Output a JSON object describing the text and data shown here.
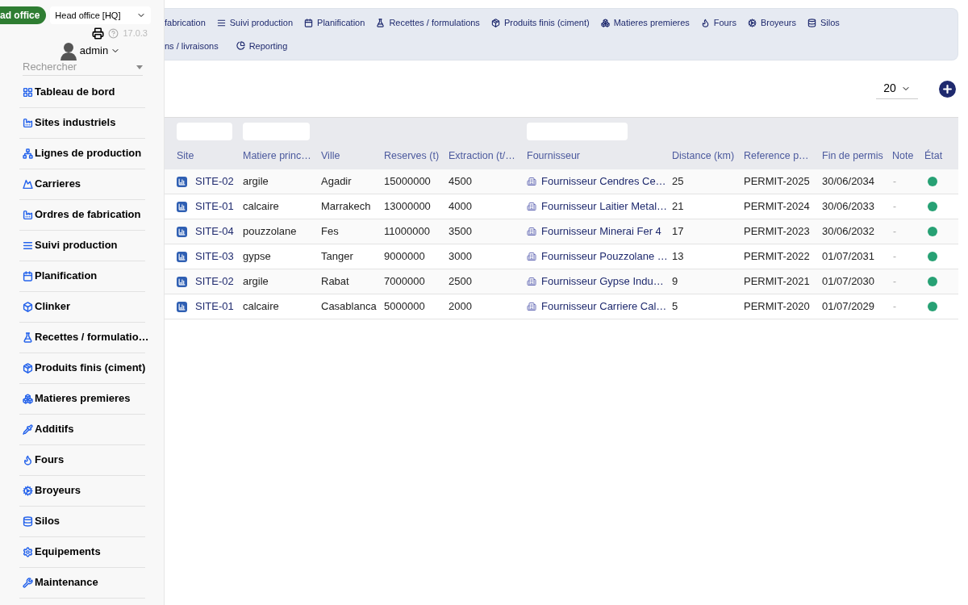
{
  "header": {
    "org_badge": "ad office",
    "site_select": "Head office [HQ]",
    "version": "17.0.3",
    "user": "admin",
    "search_placeholder": "Rechercher"
  },
  "sidebar": {
    "items": [
      {
        "label": "Tableau de bord"
      },
      {
        "label": "Sites industriels"
      },
      {
        "label": "Lignes de production"
      },
      {
        "label": "Carrieres"
      },
      {
        "label": "Ordres de fabrication"
      },
      {
        "label": "Suivi production"
      },
      {
        "label": "Planification"
      },
      {
        "label": "Clinker"
      },
      {
        "label": "Recettes / formulatio…"
      },
      {
        "label": "Produits finis (ciment)"
      },
      {
        "label": "Matieres premieres"
      },
      {
        "label": "Additifs"
      },
      {
        "label": "Fours"
      },
      {
        "label": "Broyeurs"
      },
      {
        "label": "Silos"
      },
      {
        "label": "Equipements"
      },
      {
        "label": "Maintenance"
      }
    ]
  },
  "top_nav": {
    "rows": [
      [
        "fabrication",
        "Suivi production",
        "Planification",
        "Recettes / formulations",
        "Produits finis (ciment)",
        "Matieres premieres",
        "Fours",
        "Broyeurs",
        "Silos"
      ],
      [
        "ns / livraisons",
        "Reporting"
      ]
    ]
  },
  "toolbar": {
    "page_size": "20"
  },
  "table": {
    "columns": [
      "Site",
      "Matiere princ…",
      "Ville",
      "Reserves (t)",
      "Extraction (t/…",
      "Fournisseur",
      "Distance (km)",
      "Reference p…",
      "Fin de permis",
      "Note",
      "État"
    ],
    "rows": [
      {
        "site": "SITE-02",
        "matiere": "argile",
        "ville": "Agadir",
        "reserves": "15000000",
        "extraction": "4500",
        "fournisseur": "Fournisseur Cendres Ce…",
        "distance": "25",
        "reference": "PERMIT-2025",
        "fin": "30/06/2034",
        "note": "-",
        "color": "#27a174"
      },
      {
        "site": "SITE-01",
        "matiere": "calcaire",
        "ville": "Marrakech",
        "reserves": "13000000",
        "extraction": "4000",
        "fournisseur": "Fournisseur Laitier Metal…",
        "distance": "21",
        "reference": "PERMIT-2024",
        "fin": "30/06/2033",
        "note": "-",
        "color": "#27a174"
      },
      {
        "site": "SITE-04",
        "matiere": "pouzzolane",
        "ville": "Fes",
        "reserves": "11000000",
        "extraction": "3500",
        "fournisseur": "Fournisseur Minerai Fer 4",
        "distance": "17",
        "reference": "PERMIT-2023",
        "fin": "30/06/2032",
        "note": "-",
        "color": "#27a174"
      },
      {
        "site": "SITE-03",
        "matiere": "gypse",
        "ville": "Tanger",
        "reserves": "9000000",
        "extraction": "3000",
        "fournisseur": "Fournisseur Pouzzolane …",
        "distance": "13",
        "reference": "PERMIT-2022",
        "fin": "01/07/2031",
        "note": "-",
        "color": "#27a174"
      },
      {
        "site": "SITE-02",
        "matiere": "argile",
        "ville": "Rabat",
        "reserves": "7000000",
        "extraction": "2500",
        "fournisseur": "Fournisseur Gypse Indu…",
        "distance": "9",
        "reference": "PERMIT-2021",
        "fin": "01/07/2030",
        "note": "-",
        "color": "#27a174"
      },
      {
        "site": "SITE-01",
        "matiere": "calcaire",
        "ville": "Casablanca",
        "reserves": "5000000",
        "extraction": "2000",
        "fournisseur": "Fournisseur Carriere Cal…",
        "distance": "5",
        "reference": "PERMIT-2020",
        "fin": "01/07/2029",
        "note": "-",
        "color": "#27a174"
      }
    ]
  }
}
